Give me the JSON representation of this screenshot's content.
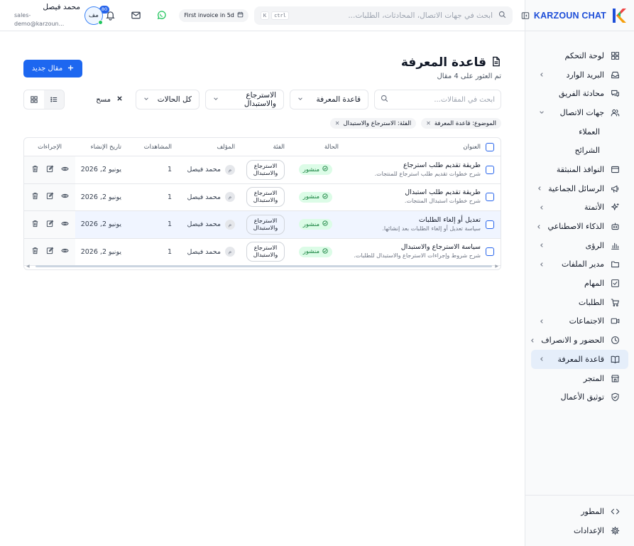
{
  "brand": {
    "name": "KARZOUN CHAT"
  },
  "sidebar": {
    "items": [
      {
        "label": "لوحة التحكم",
        "icon": "dashboard-icon",
        "chevron": false
      },
      {
        "label": "البريد الوارد",
        "icon": "inbox-icon",
        "chevron": true
      },
      {
        "label": "محادثة الفريق",
        "icon": "team-chat-icon",
        "chevron": false
      },
      {
        "label": "جهات الاتصال",
        "icon": "contacts-icon",
        "chevron": true,
        "expanded": true
      },
      {
        "label": "العملاء",
        "sub": true
      },
      {
        "label": "الشرائح",
        "sub": true
      },
      {
        "label": "النوافذ المنبثقة",
        "icon": "popup-icon",
        "chevron": false
      },
      {
        "label": "الرسائل الجماعية",
        "icon": "megaphone-icon",
        "chevron": true
      },
      {
        "label": "الأتمتة",
        "icon": "sparkles-icon",
        "chevron": true
      },
      {
        "label": "الذكاء الاصطناعي",
        "icon": "bot-icon",
        "chevron": true
      },
      {
        "label": "الرؤى",
        "icon": "chart-icon",
        "chevron": true
      },
      {
        "label": "مدير الملفات",
        "icon": "folder-icon",
        "chevron": true
      },
      {
        "label": "المهام",
        "icon": "checkbox-icon",
        "chevron": false
      },
      {
        "label": "الطلبات",
        "icon": "cart-icon",
        "chevron": false
      },
      {
        "label": "الاجتماعات",
        "icon": "video-icon",
        "chevron": true
      },
      {
        "label": "الحضور و الانصراف",
        "icon": "clock-icon",
        "chevron": true
      },
      {
        "label": "قاعدة المعرفة",
        "icon": "book-icon",
        "chevron": true,
        "active": true
      },
      {
        "label": "المتجر",
        "icon": "store-icon",
        "chevron": false
      },
      {
        "label": "توثيق الأعمال",
        "icon": "shield-check-icon",
        "chevron": false
      }
    ],
    "bottom": [
      {
        "label": "المطور",
        "icon": "code-icon"
      },
      {
        "label": "الإعدادات",
        "icon": "gear-icon"
      }
    ]
  },
  "header": {
    "search_placeholder": "ابحث في جهات الاتصال، المحادثات، الطلبات...",
    "kbd_ctrl": "ctrl",
    "kbd_k": "K",
    "invoice": "First invoice in 5d",
    "notifications_count": "80",
    "user_name": "محمد فيصل",
    "user_email": "sales-demo@karzoun...",
    "user_initials": "مف"
  },
  "page": {
    "title": "قاعدة المعرفة",
    "subtitle": "تم العثور على 4 مقال",
    "new_button": "مقال جديد"
  },
  "filters": {
    "search_placeholder": "ابحث في المقالات...",
    "topic": "قاعدة المعرفة",
    "category": "الاسترجاع والاستبدال",
    "status": "كل الحالات",
    "clear": "مسح"
  },
  "chips": [
    {
      "label": "الموضوع: قاعدة المعرفة"
    },
    {
      "label": "الفئة: الاسترجاع والاستبدال"
    }
  ],
  "table": {
    "headers": {
      "title": "العنوان",
      "status": "الحالة",
      "category": "الفئة",
      "author": "المؤلف",
      "views": "المشاهدات",
      "created": "تاريخ الإنشاء",
      "actions": "الإجراءات"
    },
    "rows": [
      {
        "title": "طريقة تقديم طلب استرجاع",
        "desc": "شرح خطوات تقديم طلب استرجاع للمنتجات.",
        "status": "منشور",
        "category": "الاسترجاع والاستبدال",
        "author_initial": "م",
        "author": "محمد فيصل",
        "views": "1",
        "date": "يونيو 2, 2026"
      },
      {
        "title": "طريقة تقديم طلب استبدال",
        "desc": "شرح خطوات استبدال المنتجات.",
        "status": "منشور",
        "category": "الاسترجاع والاستبدال",
        "author_initial": "م",
        "author": "محمد فيصل",
        "views": "1",
        "date": "يونيو 2, 2026"
      },
      {
        "title": "تعديل أو إلغاء الطلبات",
        "desc": "سياسة تعديل أو إلغاء الطلبات بعد إنشائها.",
        "status": "منشور",
        "category": "الاسترجاع والاستبدال",
        "author_initial": "م",
        "author": "محمد فيصل",
        "views": "1",
        "date": "يونيو 2, 2026"
      },
      {
        "title": "سياسة الاسترجاع والاستبدال",
        "desc": "شرح شروط وإجراءات الاسترجاع والاستبدال للطلبات.",
        "status": "منشور",
        "category": "الاسترجاع والاستبدال",
        "author_initial": "م",
        "author": "محمد فيصل",
        "views": "1",
        "date": "يونيو 2, 2026"
      }
    ]
  },
  "colors": {
    "accent": "#1d67f0",
    "status_bg": "#dcfce7",
    "status_text": "#15803d",
    "active_nav": "#e5eefa"
  }
}
